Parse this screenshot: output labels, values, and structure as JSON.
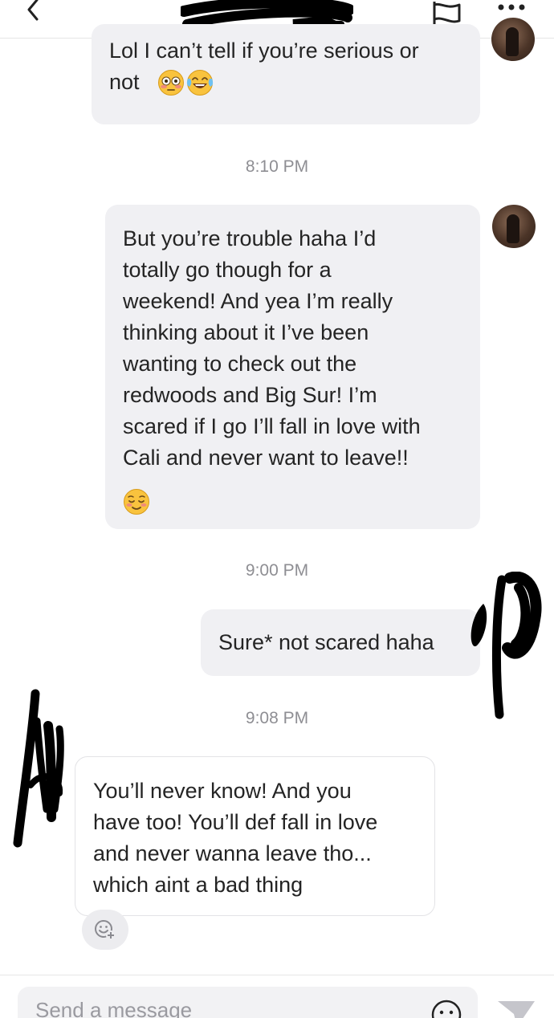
{
  "messages": [
    {
      "lines": [
        "Lol I can’t tell if you’re serious or",
        "not"
      ],
      "emoji": [
        "flushed-face",
        "tears-of-joy-face"
      ]
    },
    {
      "lines": [
        "But you’re trouble haha I’d",
        "totally go though for a",
        "weekend! And yea I’m really",
        "thinking about it I’ve been",
        "wanting to check out the",
        "redwoods and Big Sur! I’m",
        "scared if I go I’ll fall in love with",
        "Cali and never want to leave!!"
      ],
      "emoji": [
        "relieved-face"
      ]
    },
    {
      "lines": [
        "Sure* not scared haha"
      ]
    },
    {
      "lines": [
        "You’ll never know! And you",
        "have too! You’ll def fall in love",
        "and never wanna leave tho...",
        "which aint a bad thing"
      ]
    }
  ],
  "timestamps": [
    "8:10 PM",
    "9:00 PM",
    "9:08 PM"
  ],
  "composer": {
    "placeholder": "Send a message"
  },
  "colors": {
    "bubble_gray": "#f0f0f3",
    "timestamp": "#8e8e93",
    "redaction": "#000000"
  }
}
